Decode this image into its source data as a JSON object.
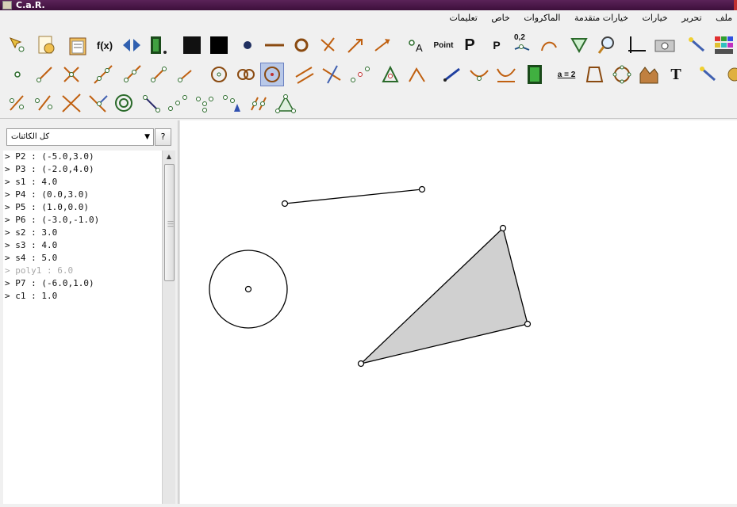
{
  "window": {
    "title": "C.a.R."
  },
  "menu": [
    "ملف",
    "تحرير",
    "خيارات",
    "خيارات متقدمة",
    "الماكروات",
    "خاص",
    "تعليمات"
  ],
  "toolbar": {
    "text_fx": "f(x)",
    "text_point": "Point",
    "text_p_big": "P",
    "text_p_small": "P",
    "text_zero_two": "0,2",
    "text_a_label": "A",
    "text_a_eq_2": "a = 2",
    "text_t": "T"
  },
  "sidebar": {
    "selector_value": "كل الكائنات",
    "help_label": "?",
    "objects": [
      {
        "text": "> P2 : (-5.0,3.0)",
        "hidden": false
      },
      {
        "text": "> P3 : (-2.0,4.0)",
        "hidden": false
      },
      {
        "text": "> s1 : 4.0",
        "hidden": false
      },
      {
        "text": "> P4 : (0.0,3.0)",
        "hidden": false
      },
      {
        "text": "> P5 : (1.0,0.0)",
        "hidden": false
      },
      {
        "text": "> P6 : (-3.0,-1.0)",
        "hidden": false
      },
      {
        "text": "> s2 : 3.0",
        "hidden": false
      },
      {
        "text": "> s3 : 4.0",
        "hidden": false
      },
      {
        "text": "> s4 : 5.0",
        "hidden": false
      },
      {
        "text": "> poly1 : 6.0",
        "hidden": true
      },
      {
        "text": "> P7 : (-6.0,1.0)",
        "hidden": false
      },
      {
        "text": "> c1 : 1.0",
        "hidden": false
      }
    ]
  },
  "colors": {
    "titlebar": "#4a1848",
    "polygon_fill": "#d0d0d0",
    "selected_tool": "#b8c8e8"
  }
}
